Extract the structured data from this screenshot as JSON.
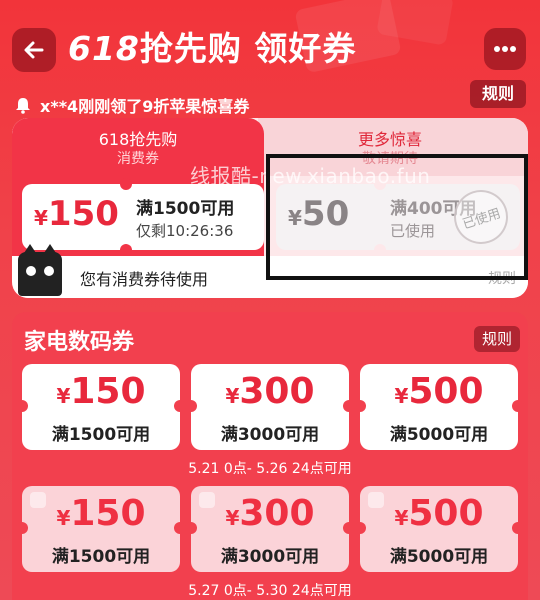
{
  "header": {
    "title_num": "618",
    "title_text": "抢先购 领好券"
  },
  "notice": {
    "text": "x**4刚刚领了9折苹果惊喜券"
  },
  "rules_label": "规则",
  "tabs": {
    "left": {
      "title": "618抢先购",
      "subtitle": "消费券"
    },
    "right": {
      "title": "更多惊喜",
      "subtitle": "敬请期待"
    }
  },
  "coupons_top": [
    {
      "currency": "¥",
      "amount": "150",
      "condition": "满1500可用",
      "subtext": "仅剩10:26:36"
    },
    {
      "currency": "¥",
      "amount": "50",
      "condition": "满400可用",
      "subtext": "已使用",
      "stamp": "已使用"
    }
  ],
  "pending": {
    "text": "您有消费券待使用",
    "rule": "规则"
  },
  "watermark": "线报酷-new.xianbao.fun",
  "section": {
    "title": "家电数码券",
    "rule": "规则",
    "row1": [
      {
        "currency": "¥",
        "amount": "150",
        "condition": "满1500可用"
      },
      {
        "currency": "¥",
        "amount": "300",
        "condition": "满3000可用"
      },
      {
        "currency": "¥",
        "amount": "500",
        "condition": "满5000可用"
      }
    ],
    "date1": "5.21 0点- 5.26 24点可用",
    "row2": [
      {
        "currency": "¥",
        "amount": "150",
        "condition": "满1500可用"
      },
      {
        "currency": "¥",
        "amount": "300",
        "condition": "满3000可用"
      },
      {
        "currency": "¥",
        "amount": "500",
        "condition": "满5000可用"
      }
    ],
    "date2": "5.27 0点- 5.30 24点可用"
  }
}
